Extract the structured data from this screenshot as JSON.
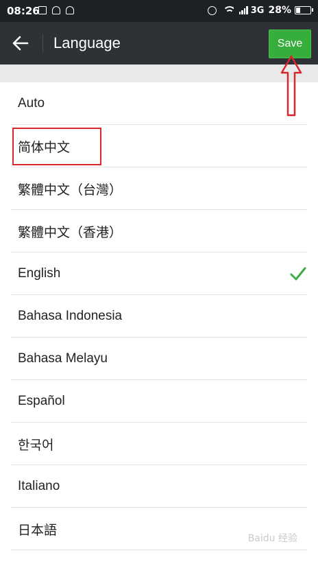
{
  "status_bar": {
    "time": "08:26",
    "network": "3G",
    "battery_percent": "28%",
    "battery_level": 0.28
  },
  "app_bar": {
    "back_icon": "arrow-left-icon",
    "title": "Language",
    "save_label": "Save"
  },
  "languages": [
    {
      "label": "Auto"
    },
    {
      "label": "简体中文"
    },
    {
      "label": "繁體中文（台灣）"
    },
    {
      "label": "繁體中文（香港）"
    },
    {
      "label": "English",
      "selected": true
    },
    {
      "label": "Bahasa Indonesia"
    },
    {
      "label": "Bahasa Melayu"
    },
    {
      "label": "Español"
    },
    {
      "label": "한국어"
    },
    {
      "label": "Italiano"
    },
    {
      "label": "日本語"
    }
  ],
  "colors": {
    "app_bar": "#2e3236",
    "save_button": "#37ad3c",
    "check": "#3dab46",
    "annotation": "#d9262a"
  },
  "watermark": "Baidu 经验"
}
